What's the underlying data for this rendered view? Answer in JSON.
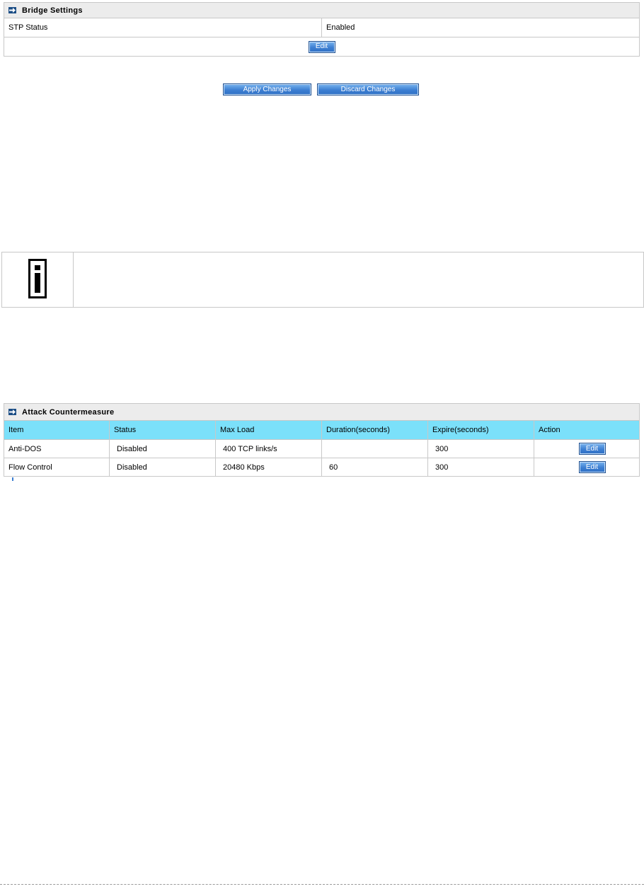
{
  "bridge": {
    "title": "Bridge Settings",
    "rows": [
      {
        "label": "STP Status",
        "value": "Enabled"
      }
    ],
    "edit_label": "Edit"
  },
  "actions": {
    "apply_label": "Apply Changes",
    "discard_label": "Discard Changes"
  },
  "note": {
    "icon": "info-icon"
  },
  "attack": {
    "title": "Attack Countermeasure",
    "columns": [
      "Item",
      "Status",
      "Max Load",
      "Duration(seconds)",
      "Expire(seconds)",
      "Action"
    ],
    "rows": [
      {
        "item": "Anti-DOS",
        "status": "Disabled",
        "max_load": "400 TCP links/s",
        "duration": "",
        "expire": "300",
        "action": "Edit"
      },
      {
        "item": "Flow Control",
        "status": "Disabled",
        "max_load": "20480 Kbps",
        "duration": "60",
        "expire": "300",
        "action": "Edit"
      }
    ]
  },
  "colors": {
    "header_row": "#7be0fa",
    "panel_title_bg": "#ececec",
    "button_blue": "#3d7fd2",
    "arrow_icon": "#1c4e86"
  }
}
